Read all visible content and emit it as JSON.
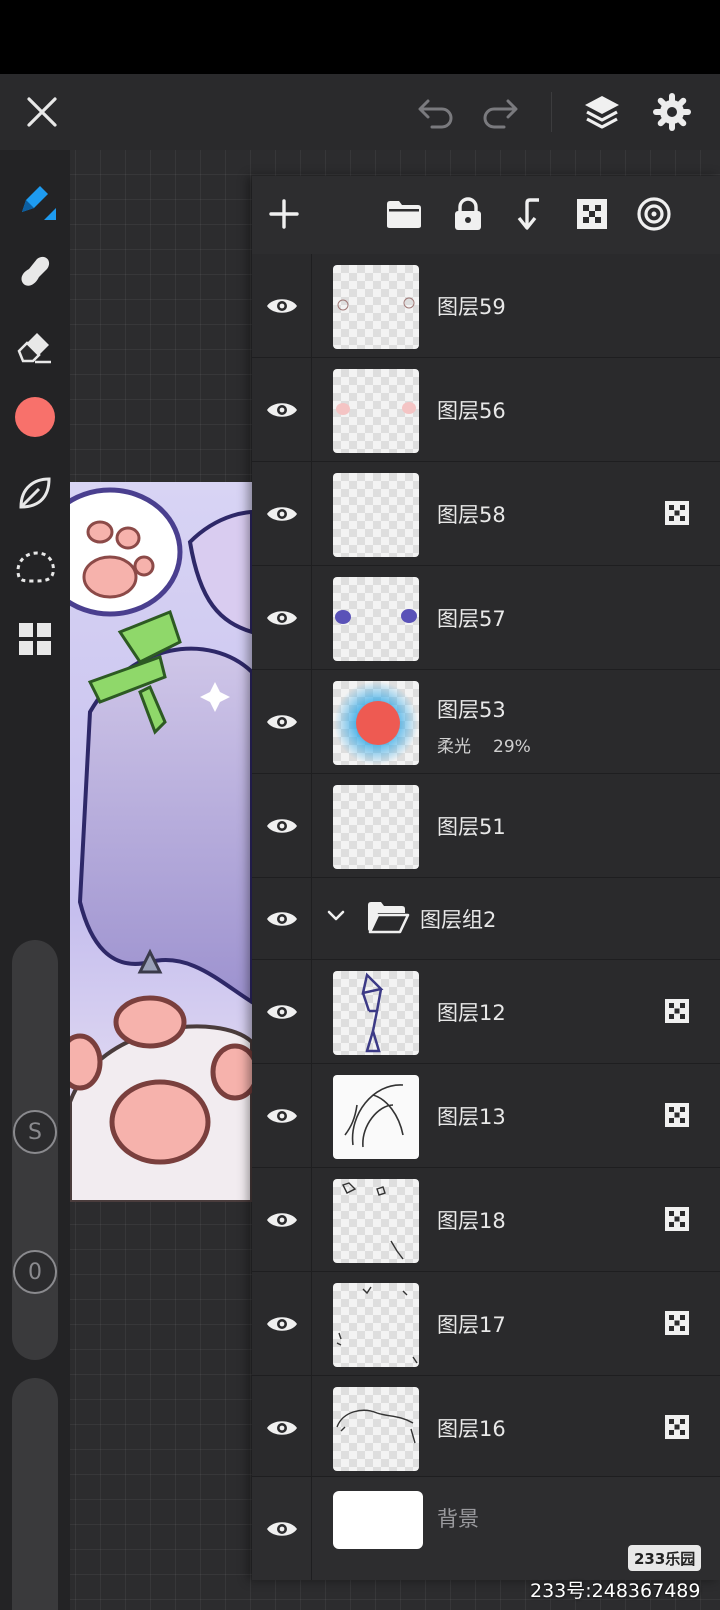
{
  "topbar": {
    "icons": [
      "close-icon",
      "undo-icon",
      "redo-icon",
      "layers-icon",
      "settings-icon"
    ]
  },
  "tools": [
    "pen-tool",
    "smudge-tool",
    "eraser-tool",
    "color-picker",
    "leaf-tool",
    "lasso-tool",
    "grid-menu"
  ],
  "current_color": "#f8716b",
  "accent_color": "#1e9bf0",
  "sliders": {
    "size_label": "S",
    "opacity_label": "0"
  },
  "panel": {
    "toolbar_icons": [
      "add-layer-icon",
      "folder-icon",
      "lock-icon",
      "merge-down-icon",
      "checker-icon",
      "blend-icon"
    ]
  },
  "layers": [
    {
      "name": "图层59",
      "visible": true,
      "alpha_lock": false
    },
    {
      "name": "图层56",
      "visible": true,
      "alpha_lock": false
    },
    {
      "name": "图层58",
      "visible": true,
      "alpha_lock": true
    },
    {
      "name": "图层57",
      "visible": true,
      "alpha_lock": false
    },
    {
      "name": "图层53",
      "visible": true,
      "alpha_lock": false,
      "blend_mode": "柔光",
      "opacity": "29%"
    },
    {
      "name": "图层51",
      "visible": true,
      "alpha_lock": false
    },
    {
      "name": "图层组2",
      "visible": true,
      "group": true,
      "expanded": true
    },
    {
      "name": "图层12",
      "visible": true,
      "alpha_lock": true
    },
    {
      "name": "图层13",
      "visible": true,
      "alpha_lock": true
    },
    {
      "name": "图层18",
      "visible": true,
      "alpha_lock": true
    },
    {
      "name": "图层17",
      "visible": true,
      "alpha_lock": true
    },
    {
      "name": "图层16",
      "visible": true,
      "alpha_lock": true
    }
  ],
  "background_layer": {
    "name": "背景",
    "visible": true
  },
  "watermark": {
    "logo": "233乐园",
    "text": "233号:248367489"
  }
}
